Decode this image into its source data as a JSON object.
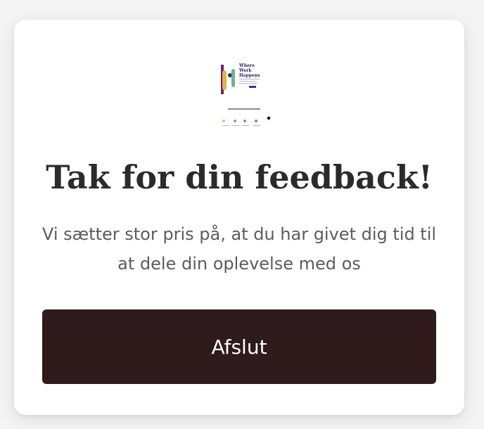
{
  "dialog": {
    "thumbnail_text": "Where Work Happens",
    "title": "Tak for din feedback!",
    "message": "Vi sætter stor pris på, at du har givet dig tid til at dele din oplevelse med os",
    "close_button_label": "Afslut"
  },
  "colors": {
    "button_background": "#2f1b1c",
    "title_text": "#2b2b2d",
    "message_text": "#5b5b63"
  }
}
